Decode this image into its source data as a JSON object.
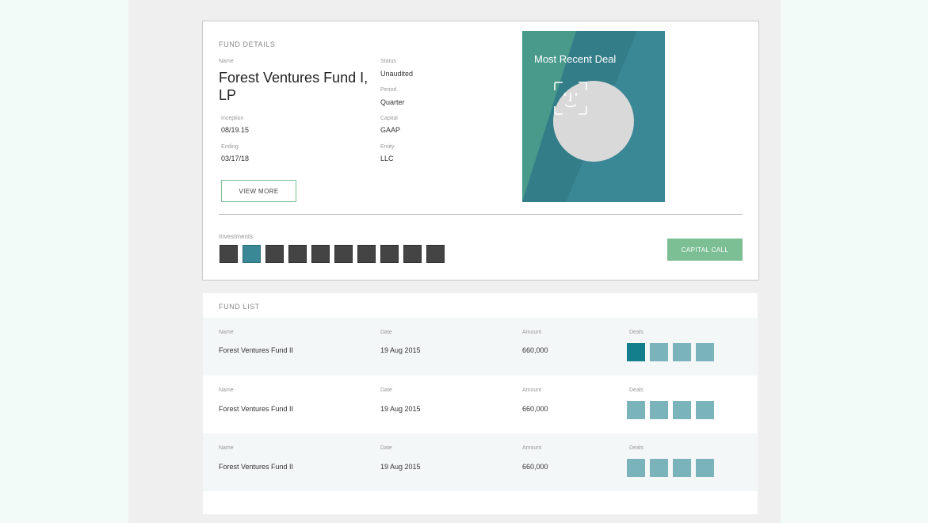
{
  "fund_details": {
    "section_title": "FUND DETAILS",
    "name_label": "Name",
    "name_value": "Forest Ventures Fund I, LP",
    "inception_label": "Inception",
    "inception_value": "08/19.15",
    "ending_label": "Ending",
    "ending_value": "03/17/18",
    "status_label": "Status",
    "status_value": "Unaudited",
    "period_label": "Period",
    "period_value": "Quarter",
    "capital_label": "Capital",
    "capital_value": "GAAP",
    "entity_label": "Entity",
    "entity_value": "LLC",
    "view_more_label": "VIEW MORE",
    "investments_label": "Investments",
    "investments": [
      {
        "active": false
      },
      {
        "active": true
      },
      {
        "active": false
      },
      {
        "active": false
      },
      {
        "active": false
      },
      {
        "active": false
      },
      {
        "active": false
      },
      {
        "active": false
      },
      {
        "active": false
      },
      {
        "active": false
      }
    ],
    "capital_call_label": "CAPITAL CALL",
    "recent_deal_title": "Most Recent Deal",
    "recent_deal_icon": "face-scan-icon"
  },
  "fund_list": {
    "section_title": "FUND LIST",
    "rows": [
      {
        "name_label": "Name",
        "name_value": "Forest Ventures Fund II",
        "date_label": "Date",
        "date_value": "19 Aug 2015",
        "amount_label": "Amount",
        "amount_value": "660,000",
        "deals_label": "Deals",
        "deals_active_index": 0
      },
      {
        "name_label": "Name",
        "name_value": "Forest Ventures Fund II",
        "date_label": "Date",
        "date_value": "19 Aug 2015",
        "amount_label": "Amount",
        "amount_value": "660,000",
        "deals_label": "Deals",
        "deals_active_index": -1
      },
      {
        "name_label": "Name",
        "name_value": "Forest Ventures Fund II",
        "date_label": "Date",
        "date_value": "19 Aug 2015",
        "amount_label": "Amount",
        "amount_value": "660,000",
        "deals_label": "Deals",
        "deals_active_index": -1
      }
    ]
  },
  "colors": {
    "accent_green": "#7cbf95",
    "teal": "#3a8795",
    "teal_light": "#7ab3ba",
    "teal_dark": "#137f8c"
  }
}
